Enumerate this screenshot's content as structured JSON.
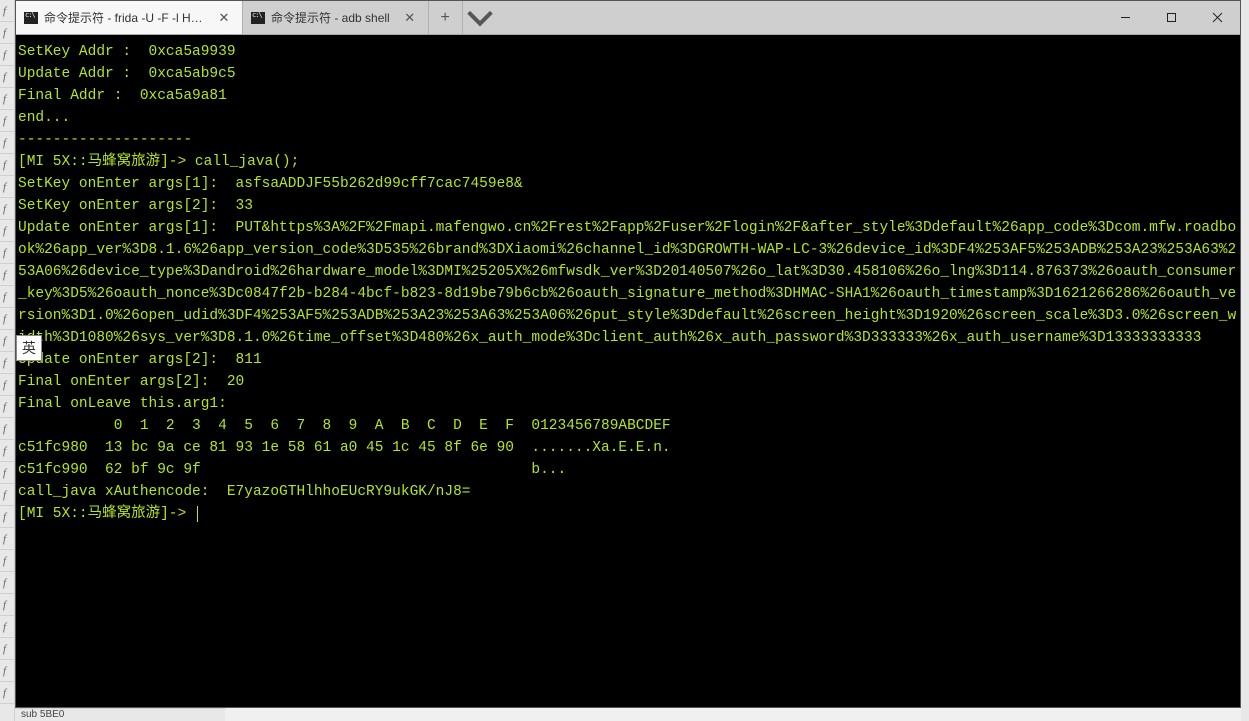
{
  "background": {
    "left_items": [
      "f",
      "f",
      "f",
      "f",
      "f",
      "f",
      "f",
      "f",
      "f",
      "f",
      "f",
      "f",
      "f",
      "f",
      "f",
      "f",
      "f",
      "f",
      "f",
      "f",
      "f",
      "f",
      "f",
      "f",
      "f",
      "f",
      "f",
      "f",
      "f",
      "f",
      "f",
      "f"
    ],
    "bottom_text": "sub 5BE0"
  },
  "titlebar": {
    "tabs": [
      {
        "title": "命令提示符 - frida  -U  -F -l Hool",
        "active": true
      },
      {
        "title": "命令提示符 - adb  shell",
        "active": false
      }
    ]
  },
  "ime": {
    "label": "英"
  },
  "terminal": {
    "lines": [
      "SetKey Addr :  0xca5a9939",
      "Update Addr :  0xca5ab9c5",
      "Final Addr :  0xca5a9a81",
      "end...",
      "--------------------",
      "[MI 5X::马蜂窝旅游]-> call_java();",
      "SetKey onEnter args[1]:  asfsaADDJF55b262d99cff7cac7459e8&",
      "SetKey onEnter args[2]:  33",
      "Update onEnter args[1]:  PUT&https%3A%2F%2Fmapi.mafengwo.cn%2Frest%2Fapp%2Fuser%2Flogin%2F&after_style%3Ddefault%26app_code%3Dcom.mfw.roadbook%26app_ver%3D8.1.6%26app_version_code%3D535%26brand%3DXiaomi%26channel_id%3DGROWTH-WAP-LC-3%26device_id%3DF4%253AF5%253ADB%253A23%253A63%253A06%26device_type%3Dandroid%26hardware_model%3DMI%25205X%26mfwsdk_ver%3D20140507%26o_lat%3D30.458106%26o_lng%3D114.876373%26oauth_consumer_key%3D5%26oauth_nonce%3Dc0847f2b-b284-4bcf-b823-8d19be79b6cb%26oauth_signature_method%3DHMAC-SHA1%26oauth_timestamp%3D1621266286%26oauth_version%3D1.0%26open_udid%3DF4%253AF5%253ADB%253A23%253A63%253A06%26put_style%3Ddefault%26screen_height%3D1920%26screen_scale%3D3.0%26screen_width%3D1080%26sys_ver%3D8.1.0%26time_offset%3D480%26x_auth_mode%3Dclient_auth%26x_auth_password%3D333333%26x_auth_username%3D13333333333",
      "Update onEnter args[2]:  811",
      "Final onEnter args[2]:  20",
      "Final onLeave this.arg1:",
      "           0  1  2  3  4  5  6  7  8  9  A  B  C  D  E  F  0123456789ABCDEF",
      "c51fc980  13 bc 9a ce 81 93 1e 58 61 a0 45 1c 45 8f 6e 90  .......Xa.E.E.n.",
      "c51fc990  62 bf 9c 9f                                      b...",
      "call_java xAuthencode:  E7yazoGTHlhhoEUcRY9ukGK/nJ8="
    ],
    "prompt": "[MI 5X::马蜂窝旅游]-> "
  }
}
